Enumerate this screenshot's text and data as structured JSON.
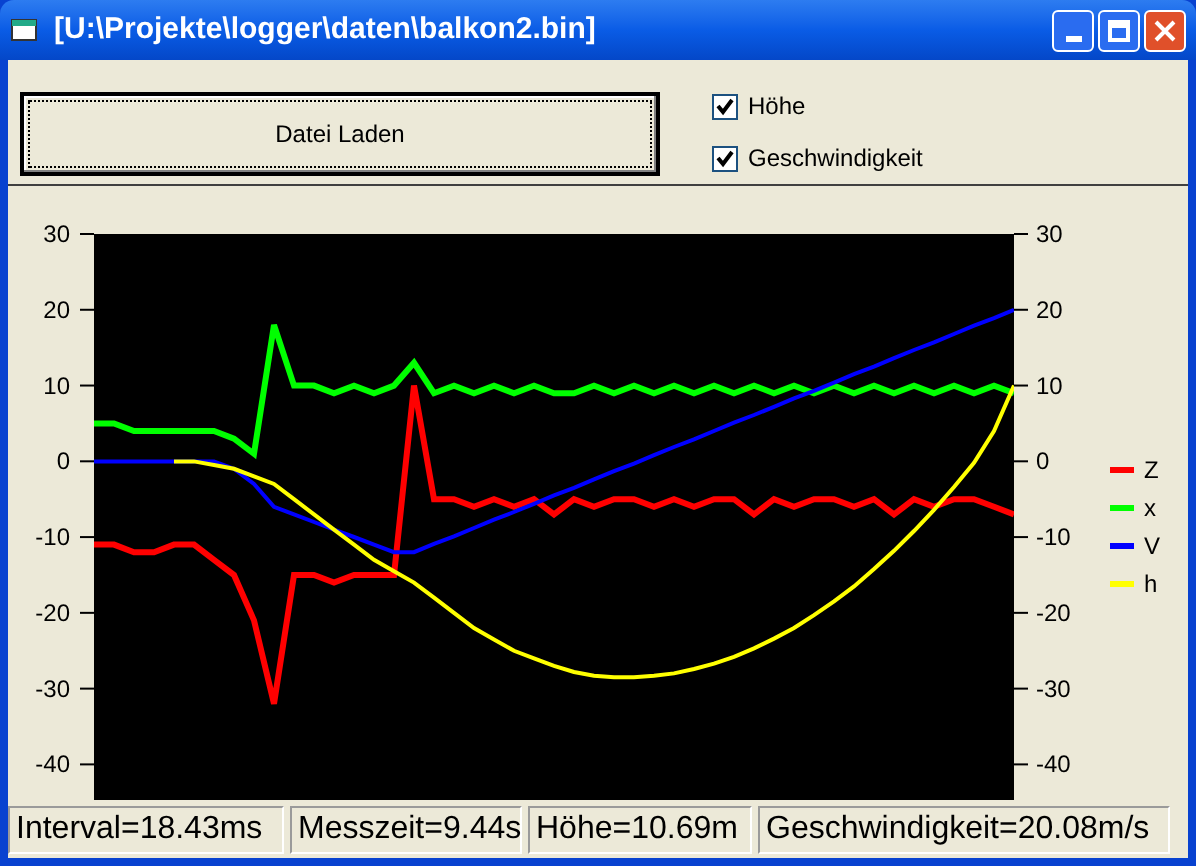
{
  "window": {
    "title": "[U:\\Projekte\\logger\\daten\\balkon2.bin]"
  },
  "load_button": {
    "label": "Datei Laden"
  },
  "checkboxes": [
    {
      "label": "Höhe",
      "checked": true
    },
    {
      "label": "Geschwindigkeit",
      "checked": true
    }
  ],
  "plot": {
    "chart_data": {
      "type": "line",
      "categories": [
        null,
        null,
        null,
        null,
        null,
        null,
        null,
        null,
        null,
        null,
        null,
        null,
        null,
        null,
        null,
        null,
        null,
        null,
        null,
        null,
        null,
        null,
        null,
        null,
        null,
        null,
        null,
        null,
        null,
        null,
        null,
        null,
        null,
        null,
        null,
        null,
        null,
        null,
        null,
        null,
        null,
        null,
        null,
        null,
        null,
        null,
        null
      ],
      "ylim": [
        -44.7,
        30
      ],
      "yticks": [
        30,
        20,
        10,
        0,
        -10,
        -20,
        -30,
        -40
      ],
      "series": [
        {
          "name": "Z",
          "color": "#ff0000",
          "values": [
            -11,
            -11,
            -12,
            -12,
            -11,
            -11,
            -13,
            -15,
            -21,
            -32,
            -15,
            -15,
            -16,
            -15,
            -15,
            -15,
            10,
            -5,
            -5,
            -6,
            -5,
            -6,
            -5,
            -7,
            -5,
            -6,
            -5,
            -5,
            -6,
            -5,
            -6,
            -5,
            -5,
            -7,
            -5,
            -6,
            -5,
            -5,
            -6,
            -5,
            -7,
            -5,
            -6,
            -5,
            -5,
            -6,
            -7
          ]
        },
        {
          "name": "x",
          "color": "#00ff00",
          "values": [
            5,
            5,
            4,
            4,
            4,
            4,
            4,
            3,
            1,
            18,
            10,
            10,
            9,
            10,
            9,
            10,
            13,
            9,
            10,
            9,
            10,
            9,
            10,
            9,
            9,
            10,
            9,
            10,
            9,
            10,
            9,
            10,
            9,
            10,
            9,
            10,
            9,
            10,
            9,
            10,
            9,
            10,
            9,
            10,
            9,
            10,
            9
          ]
        },
        {
          "name": "V",
          "color": "#0000ff",
          "values": [
            0,
            0,
            0,
            0,
            0,
            0,
            0,
            -1,
            -3,
            -6,
            -7,
            -8,
            -9,
            -10,
            -11,
            -12,
            -12,
            -10.9,
            -9.9,
            -8.8,
            -7.7,
            -6.7,
            -5.6,
            -4.5,
            -3.5,
            -2.4,
            -1.3,
            -0.3,
            0.8,
            1.9,
            2.9,
            4,
            5.1,
            6.1,
            7.2,
            8.3,
            9.3,
            10.4,
            11.5,
            12.5,
            13.6,
            14.7,
            15.7,
            16.8,
            17.9,
            18.9,
            20
          ]
        },
        {
          "name": "h",
          "color": "#ffff00",
          "values": [
            null,
            null,
            null,
            null,
            0,
            0,
            -0.5,
            -1,
            -2,
            -3,
            -5,
            -7,
            -9,
            -11,
            -13,
            -14.5,
            -16,
            -18,
            -20,
            -22,
            -23.5,
            -25,
            -26,
            -27,
            -27.8,
            -28.3,
            -28.5,
            -28.5,
            -28.3,
            -28,
            -27.4,
            -26.7,
            -25.8,
            -24.7,
            -23.4,
            -22,
            -20.3,
            -18.5,
            -16.5,
            -14.2,
            -11.8,
            -9.2,
            -6.4,
            -3.4,
            -0.2,
            4,
            10
          ]
        }
      ],
      "legend": "right"
    },
    "right_axis_labels": [
      "30",
      "20",
      "10",
      "0",
      "-10",
      "-20",
      "-30",
      "-40"
    ]
  },
  "status_bar": [
    "Interval=18.43ms",
    "Messzeit=9.44s",
    "Höhe=10.69m",
    "Geschwindigkeit=20.08m/s"
  ]
}
